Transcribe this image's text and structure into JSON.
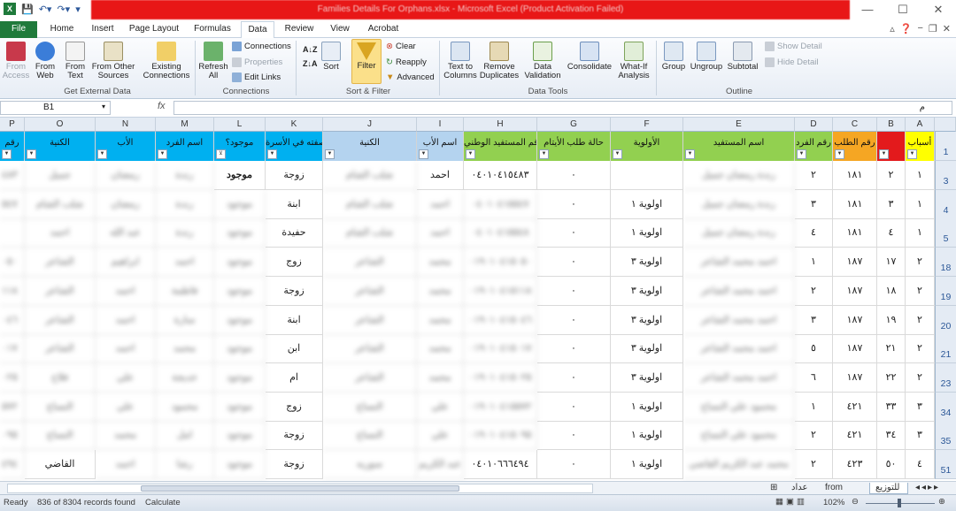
{
  "window": {
    "title": "Families Details For Orphans.xlsx  -  Microsoft Excel (Product Activation Failed)",
    "controls": [
      "—",
      "☐",
      "✕"
    ]
  },
  "quick_access": [
    "save-icon",
    "undo-icon",
    "redo-icon",
    "customize-icon"
  ],
  "tabs": [
    "File",
    "Home",
    "Insert",
    "Page Layout",
    "Formulas",
    "Data",
    "Review",
    "View",
    "Acrobat"
  ],
  "active_tab": "Data",
  "ribbon": {
    "get_external": {
      "label": "Get External Data",
      "from_access": "From Access",
      "from_web": "From Web",
      "from_text": "From Text",
      "from_other": "From Other Sources",
      "existing": "Existing Connections"
    },
    "connections": {
      "label": "Connections",
      "refresh": "Refresh All",
      "connections": "Connections",
      "properties": "Properties",
      "edit_links": "Edit Links"
    },
    "sort_filter": {
      "label": "Sort & Filter",
      "sort": "Sort",
      "filter": "Filter",
      "clear": "Clear",
      "reapply": "Reapply",
      "advanced": "Advanced"
    },
    "data_tools": {
      "label": "Data Tools",
      "text_to_columns": "Text to Columns",
      "remove_dup": "Remove Duplicates",
      "validation": "Data Validation",
      "consolidate": "Consolidate",
      "what_if": "What-If Analysis"
    },
    "outline": {
      "label": "Outline",
      "group": "Group",
      "ungroup": "Ungroup",
      "subtotal": "Subtotal",
      "show_detail": "Show Detail",
      "hide_detail": "Hide Detail"
    }
  },
  "formula_bar": {
    "name_box": "B1",
    "fx": "fx",
    "value": "م"
  },
  "columns": [
    "A",
    "B",
    "C",
    "D",
    "E",
    "F",
    "G",
    "H",
    "I",
    "J",
    "K",
    "L",
    "M",
    "N",
    "O",
    "P"
  ],
  "headers": {
    "A": "أسباب",
    "B": "",
    "C": "رقم الطلب",
    "D": "رقم الفرد",
    "E": "اسم المستفيد",
    "F": "الأولوية",
    "G": "حالة طلب الأيتام",
    "H": "رقم المستفيد الوطني",
    "I": "اسم الأب",
    "J": "الكنية",
    "K": "صفته في الأسرة",
    "L": "موجود؟",
    "M": "اسم الفرد",
    "N": "الأب",
    "O": "الكنية",
    "P": "رقم"
  },
  "header_colors": {
    "A": "#ffff00",
    "B": "#e31a1c",
    "C": "#f5a623",
    "D": "#92d050",
    "E": "#92d050",
    "F": "#92d050",
    "G": "#92d050",
    "H": "#92d050",
    "I": "#b4d3ef",
    "J": "#b4d3ef",
    "K": "#00b0f0",
    "L": "#00b0f0",
    "M": "#00b0f0",
    "N": "#00b0f0",
    "O": "#00b0f0",
    "P": "#00b0f0"
  },
  "rows": [
    {
      "num": "3",
      "A": "١",
      "B": "٢",
      "C": "١٨١",
      "D": "٢",
      "E": "رندة رمضان جميل",
      "F": "",
      "G": "٠",
      "H": "٠٤٠١٠٤١٥٤٨٣",
      "I": "احمد",
      "J": "شلب الشام",
      "K": "زوجة",
      "L": "موجود",
      "M": "رندة",
      "N": "رمضان",
      "O": "جميل",
      "P": "٤٨٣"
    },
    {
      "num": "4",
      "A": "١",
      "B": "٣",
      "C": "١٨١",
      "D": "٣",
      "E": "رندة رمضان جميل",
      "F": "اولوية ١",
      "G": "٠",
      "H": "٠٤٠١٠٤١٥٥٤٧",
      "I": "احمد",
      "J": "شلب الشام",
      "K": "ابنة",
      "L": "موجود",
      "M": "رندة",
      "N": "رمضان",
      "O": "شلب الشام",
      "P": "٥٤٧"
    },
    {
      "num": "5",
      "A": "١",
      "B": "٤",
      "C": "١٨١",
      "D": "٤",
      "E": "رندة رمضان جميل",
      "F": "اولوية ١",
      "G": "٠",
      "H": "٠٤٠١٠٤١٥٥٤٨",
      "I": "احمد",
      "J": "شلب الشام",
      "K": "حفيدة",
      "L": "موجود",
      "M": "رندة",
      "N": "عبد الله",
      "O": "احمد",
      "P": ""
    },
    {
      "num": "18",
      "A": "٢",
      "B": "١٧",
      "C": "١٨٧",
      "D": "١",
      "E": "احمد محمد الشاعر",
      "F": "اولوية ٣",
      "G": "٠",
      "H": "٠١٩٠١٠٤١٥٠٥٠",
      "I": "محمد",
      "J": "الشاعر",
      "K": "زوج",
      "L": "موجود",
      "M": "احمد",
      "N": "ابراهيم",
      "O": "الشاعر",
      "P": "٠٥٠"
    },
    {
      "num": "19",
      "A": "٢",
      "B": "١٨",
      "C": "١٨٧",
      "D": "٢",
      "E": "احمد محمد الشاعر",
      "F": "اولوية ٣",
      "G": "٠",
      "H": "٠١٩٠١٠٤١٥١١٨",
      "I": "محمد",
      "J": "الشاعر",
      "K": "زوجة",
      "L": "موجود",
      "M": "فاطمة",
      "N": "احمد",
      "O": "الشاعر",
      "P": "١١٨"
    },
    {
      "num": "20",
      "A": "٢",
      "B": "١٩",
      "C": "١٨٧",
      "D": "٣",
      "E": "احمد محمد الشاعر",
      "F": "اولوية ٣",
      "G": "٠",
      "H": "٠١٩٠١٠٤١٥٠٤٦",
      "I": "محمد",
      "J": "الشاعر",
      "K": "ابنة",
      "L": "موجود",
      "M": "سارة",
      "N": "احمد",
      "O": "الشاعر",
      "P": "٠٤٦"
    },
    {
      "num": "21",
      "A": "٢",
      "B": "٢١",
      "C": "١٨٧",
      "D": "٥",
      "E": "احمد محمد الشاعر",
      "F": "اولوية ٣",
      "G": "٠",
      "H": "٠١٩٠١٠٤١٥٠١٧",
      "I": "محمد",
      "J": "الشاعر",
      "K": "ابن",
      "L": "موجود",
      "M": "محمد",
      "N": "احمد",
      "O": "الشاعر",
      "P": "٠١٧"
    },
    {
      "num": "23",
      "A": "٢",
      "B": "٢٢",
      "C": "١٨٧",
      "D": "٦",
      "E": "احمد محمد الشاعر",
      "F": "اولوية ٣",
      "G": "٠",
      "H": "٠١٩٠١٠٤١٥٠٢٥",
      "I": "محمد",
      "J": "الشاعر",
      "K": "ام",
      "L": "موجود",
      "M": "خديجة",
      "N": "علي",
      "O": "فلاح",
      "P": "٠٢٥"
    },
    {
      "num": "34",
      "A": "٣",
      "B": "٣٣",
      "C": "٤٢١",
      "D": "١",
      "E": "محمود علي النساج",
      "F": "اولوية ١",
      "G": "٠",
      "H": "٠١٩٠١٠٤١٥٥٧٢",
      "I": "علي",
      "J": "النساج",
      "K": "زوج",
      "L": "موجود",
      "M": "محمود",
      "N": "علي",
      "O": "النساج",
      "P": "٥٧٢"
    },
    {
      "num": "35",
      "A": "٣",
      "B": "٣٤",
      "C": "٤٢١",
      "D": "٢",
      "E": "محمود علي النساج",
      "F": "اولوية ١",
      "G": "٠",
      "H": "٠١٩٠١٠٤١٥٠٩٥",
      "I": "علي",
      "J": "النساج",
      "K": "زوجة",
      "L": "موجود",
      "M": "امل",
      "N": "محمد",
      "O": "النساج",
      "P": "٠٩٥"
    },
    {
      "num": "51",
      "A": "٤",
      "B": "٥٠",
      "C": "٤٢٣",
      "D": "٢",
      "E": "محمد عبد الكريم القاضي",
      "F": "اولوية ١",
      "G": "٠",
      "H": "٠٤٠١٠٦٦٦٤٩٤",
      "I": "عبد الكريم",
      "J": "سوريه",
      "K": "زوجة",
      "L": "موجود",
      "M": "رشا",
      "N": "احمد",
      "O": "القاضي",
      "P": "٤٩٤"
    }
  ],
  "sheets": [
    "للتوزيع",
    "from Data",
    "عداد"
  ],
  "status": {
    "mode": "Ready",
    "records": "836 of 8304 records found",
    "calc": "Calculate",
    "zoom": "102%"
  }
}
